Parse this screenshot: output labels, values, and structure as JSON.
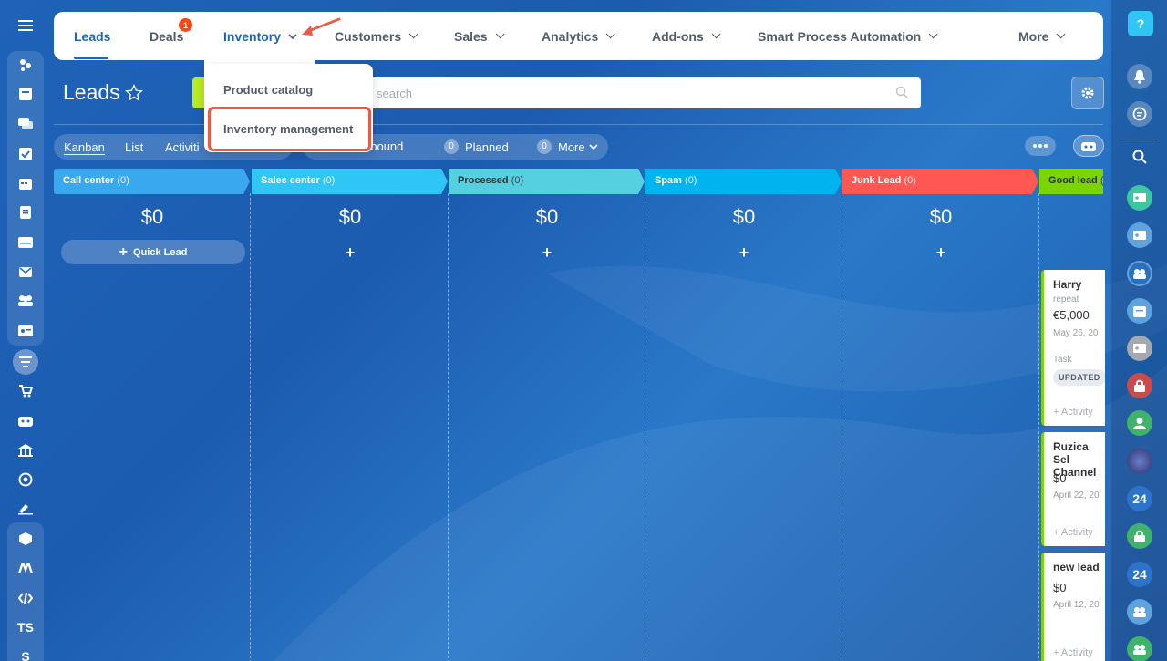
{
  "nav": {
    "items": [
      {
        "label": "Leads"
      },
      {
        "label": "Deals",
        "badge": "1"
      },
      {
        "label": "Inventory"
      },
      {
        "label": "Customers"
      },
      {
        "label": "Sales"
      },
      {
        "label": "Analytics"
      },
      {
        "label": "Add-ons"
      },
      {
        "label": "Smart Process Automation"
      },
      {
        "label": "More"
      }
    ]
  },
  "dropdown": {
    "items": [
      "Product catalog",
      "Inventory management"
    ]
  },
  "page": {
    "title": "Leads",
    "search_placeholder": "search"
  },
  "views": {
    "tabs": [
      "Kanban",
      "List",
      "Activiti"
    ]
  },
  "counters": {
    "inbound_label": "nbound",
    "planned_count": "0",
    "planned_label": "Planned",
    "more_count": "0",
    "more_label": "More"
  },
  "columns": [
    {
      "name": "Call center",
      "count": "(0)",
      "sum": "$0",
      "color": "#39a8ef"
    },
    {
      "name": "Sales center",
      "count": "(0)",
      "sum": "$0",
      "color": "#2fc6f6"
    },
    {
      "name": "Processed",
      "count": "(0)",
      "sum": "$0",
      "color": "#55d0e0"
    },
    {
      "name": "Spam",
      "count": "(0)",
      "sum": "$0",
      "color": "#00b4f0"
    },
    {
      "name": "Junk Lead",
      "count": "(0)",
      "sum": "$0",
      "color": "#ff5752"
    },
    {
      "name": "Good lead",
      "count": "(",
      "color": "#7bd500"
    }
  ],
  "quick_lead_label": "Quick Lead",
  "add_symbol": "+",
  "cards": [
    {
      "name": "Harry",
      "sub": "repeat",
      "amount": "€5,000",
      "date": "May 26, 20",
      "task": "Task",
      "badge": "UPDATED",
      "activity": "+ Activity"
    },
    {
      "name": "Ruzica Sel Channel",
      "amount": "$0",
      "date": "April 22, 20",
      "activity": "+ Activity"
    },
    {
      "name": "new lead",
      "amount": "$0",
      "date": "April 12, 20",
      "activity": "+ Activity"
    }
  ],
  "left_bar": {
    "ts_label": "TS",
    "s_label": "S"
  },
  "right_bar": {
    "help_label": "?",
    "b24_label": "24"
  }
}
